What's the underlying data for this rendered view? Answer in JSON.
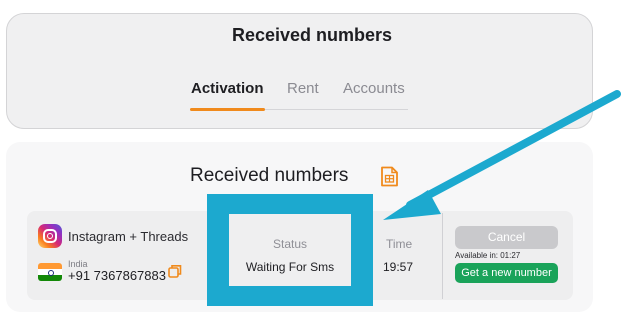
{
  "header": {
    "title": "Received numbers",
    "tabs": [
      {
        "label": "Activation",
        "active": true
      },
      {
        "label": "Rent",
        "active": false
      },
      {
        "label": "Accounts",
        "active": false
      }
    ],
    "accent_color": "#f08a1c"
  },
  "numbers_section": {
    "title": "Received numbers",
    "export_icon": "spreadsheet-icon"
  },
  "order": {
    "service": {
      "icon": "instagram-icon",
      "name": "Instagram + Threads"
    },
    "country": {
      "icon": "india-flag-icon",
      "name": "India"
    },
    "phone": "+91 7367867883",
    "copy_icon": "copy-icon",
    "status_label": "Status",
    "status_value": "Waiting For Sms",
    "time_label": "Time",
    "time_value": "19:57",
    "cancel_label": "Cancel",
    "available_text": "Available in:  01:27",
    "new_number_label": "Get a new number",
    "new_number_color": "#1aa35a"
  },
  "annotation": {
    "highlight_color": "#1ca9cf",
    "arrow_icon": "arrow-icon"
  }
}
